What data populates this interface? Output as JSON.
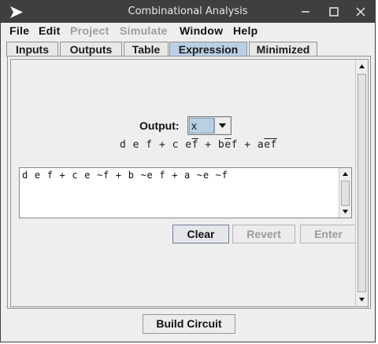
{
  "window": {
    "title": "Combinational Analysis"
  },
  "menu": {
    "items": [
      {
        "label": "File",
        "enabled": true
      },
      {
        "label": "Edit",
        "enabled": true
      },
      {
        "label": "Project",
        "enabled": false
      },
      {
        "label": "Simulate",
        "enabled": false
      },
      {
        "label": "Window",
        "enabled": true
      },
      {
        "label": "Help",
        "enabled": true
      }
    ]
  },
  "tabs": [
    {
      "label": "Inputs"
    },
    {
      "label": "Outputs"
    },
    {
      "label": "Table"
    },
    {
      "label": "Expression",
      "active": true
    },
    {
      "label": "Minimized"
    }
  ],
  "expression": {
    "output_label": "Output:",
    "output_selected": "x",
    "formula_terms": [
      "d e f",
      "+",
      "c e",
      "f",
      "+",
      "b",
      "e",
      "f",
      "+",
      "a",
      "e",
      "f"
    ],
    "expression_text": "d e f + c e ~f + b ~e f + a ~e ~f",
    "clear_label": "Clear",
    "revert_label": "Revert",
    "enter_label": "Enter"
  },
  "footer": {
    "build_label": "Build Circuit"
  },
  "colors": {
    "titlebar": "#3f3f3f",
    "active_tab": "#b9cfe4",
    "window_bg": "#eeeeee"
  }
}
